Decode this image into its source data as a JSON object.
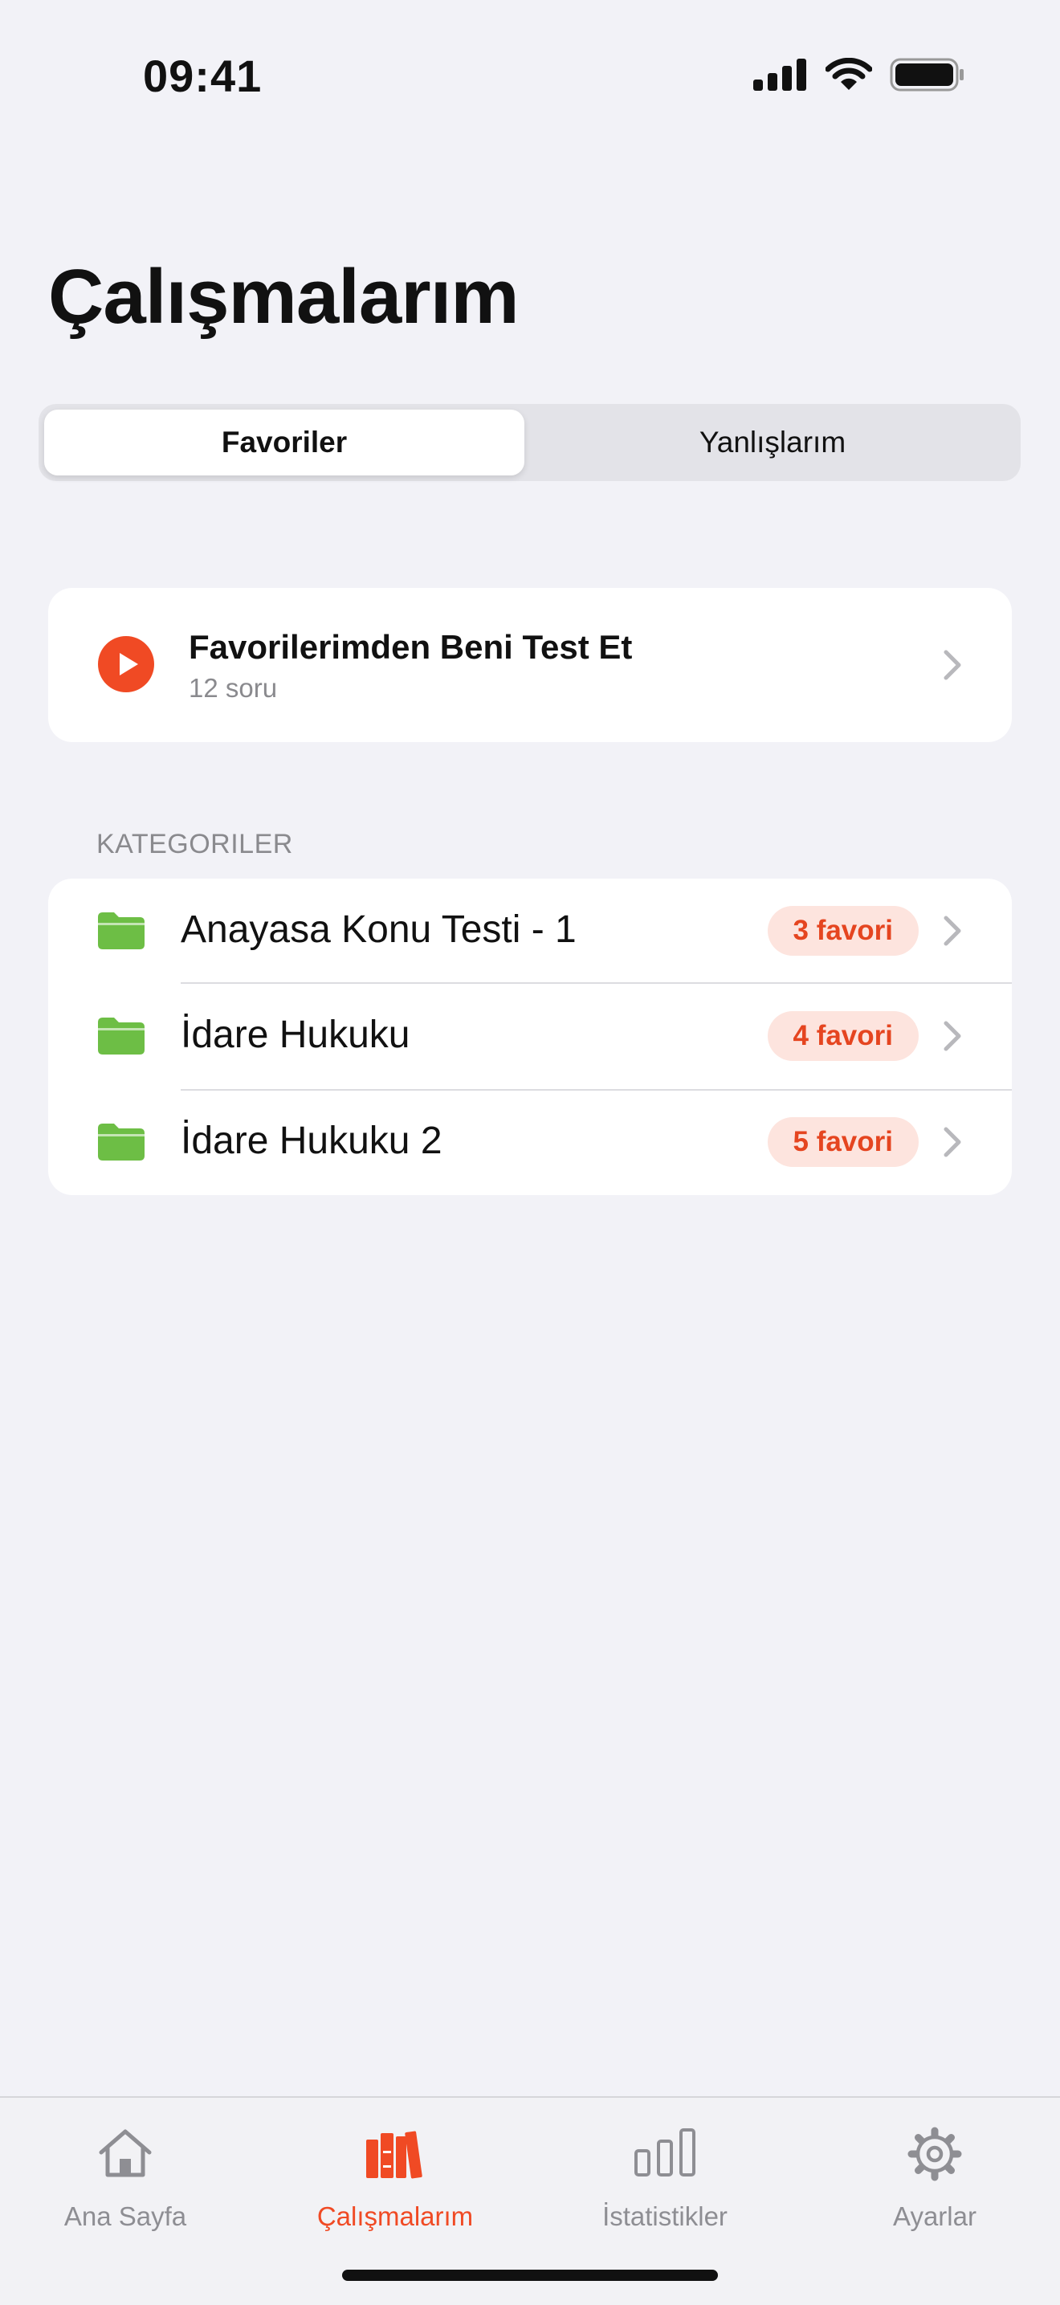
{
  "status": {
    "time": "09:41"
  },
  "page": {
    "title": "Çalışmalarım"
  },
  "segments": [
    {
      "label": "Favoriler",
      "selected": true
    },
    {
      "label": "Yanlışlarım",
      "selected": false
    }
  ],
  "test_card": {
    "title": "Favorilerimden Beni Test Et",
    "subtitle": "12 soru"
  },
  "categories": {
    "section_label": "KATEGORILER",
    "items": [
      {
        "label": "Anayasa Konu Testi - 1",
        "badge": "3 favori"
      },
      {
        "label": "İdare Hukuku",
        "badge": "4 favori"
      },
      {
        "label": "İdare Hukuku 2",
        "badge": "5 favori"
      }
    ]
  },
  "tabs": [
    {
      "label": "Ana Sayfa",
      "icon": "house-icon",
      "active": false
    },
    {
      "label": "Çalışmalarım",
      "icon": "books-icon",
      "active": true
    },
    {
      "label": "İstatistikler",
      "icon": "chart-bars-icon",
      "active": false
    },
    {
      "label": "Ayarlar",
      "icon": "gear-icon",
      "active": false
    }
  ],
  "colors": {
    "accent": "#F04A24",
    "folder": "#6DBE45",
    "badge_bg": "#FDE4DE",
    "background": "#F2F2F7"
  }
}
